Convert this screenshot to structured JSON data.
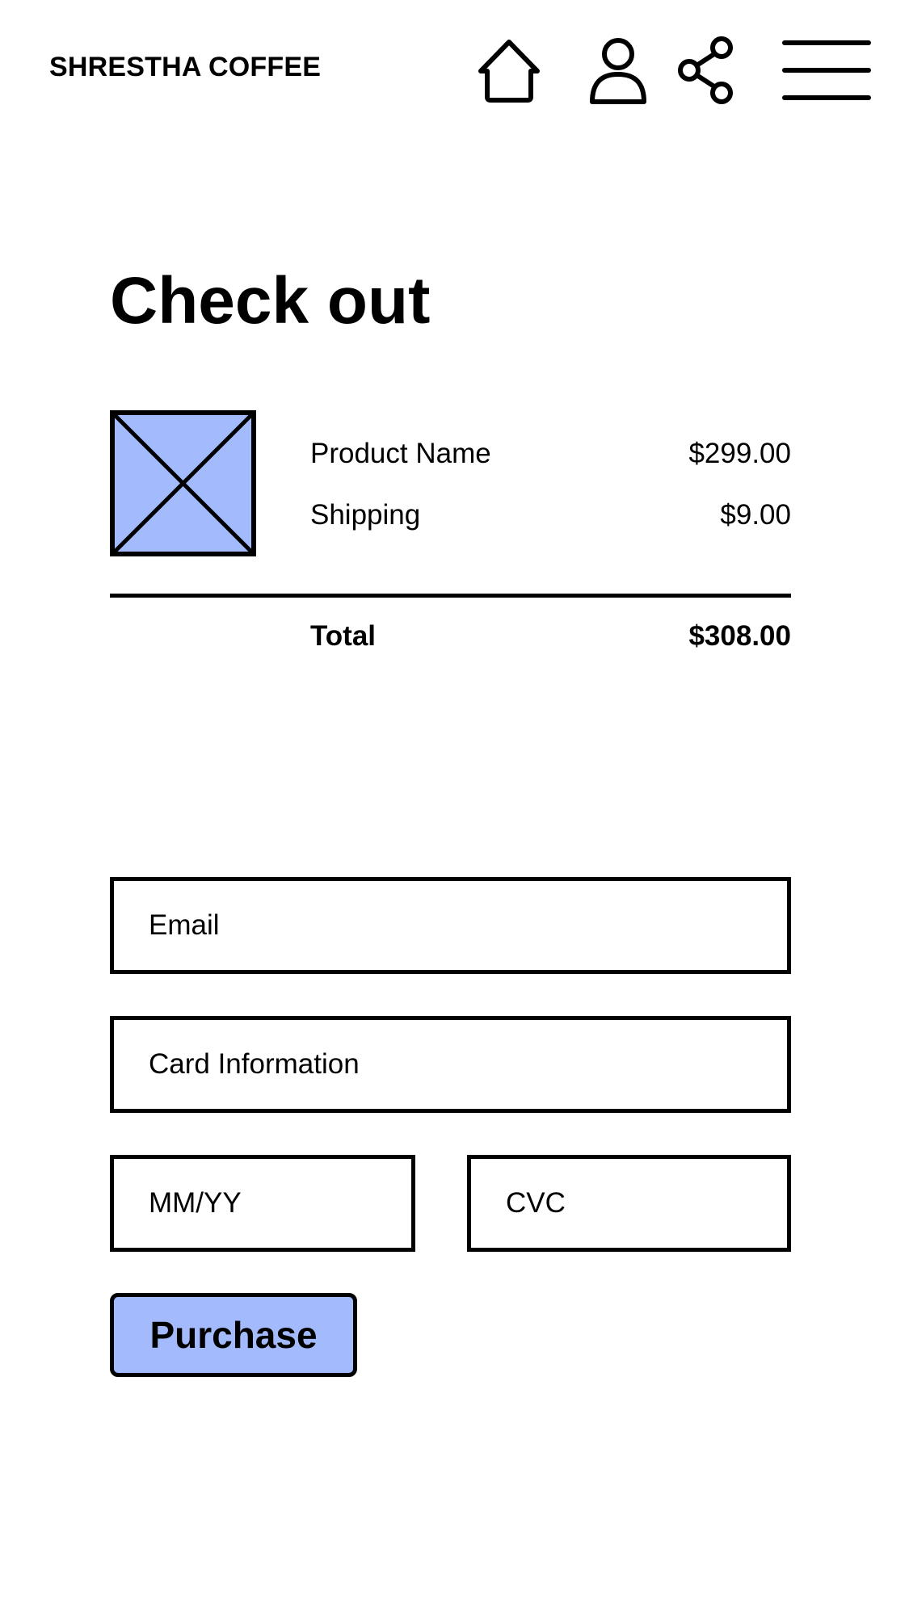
{
  "header": {
    "brand": "SHRESTHA COFFEE",
    "icons": [
      "home-icon",
      "user-icon",
      "share-icon",
      "menu-icon"
    ]
  },
  "checkout": {
    "title": "Check out",
    "product_image_icon": "image-placeholder-icon",
    "lines": [
      {
        "label": "Product Name",
        "value": "$299.00"
      },
      {
        "label": "Shipping",
        "value": "$9.00"
      }
    ],
    "total": {
      "label": "Total",
      "value": "$308.00"
    }
  },
  "form": {
    "email_placeholder": "Email",
    "card_placeholder": "Card Information",
    "expiry_placeholder": "MM/YY",
    "cvc_placeholder": "CVC",
    "purchase_label": "Purchase"
  },
  "colors": {
    "accent": "#a3bbfc",
    "stroke": "#000000",
    "background": "#ffffff"
  }
}
